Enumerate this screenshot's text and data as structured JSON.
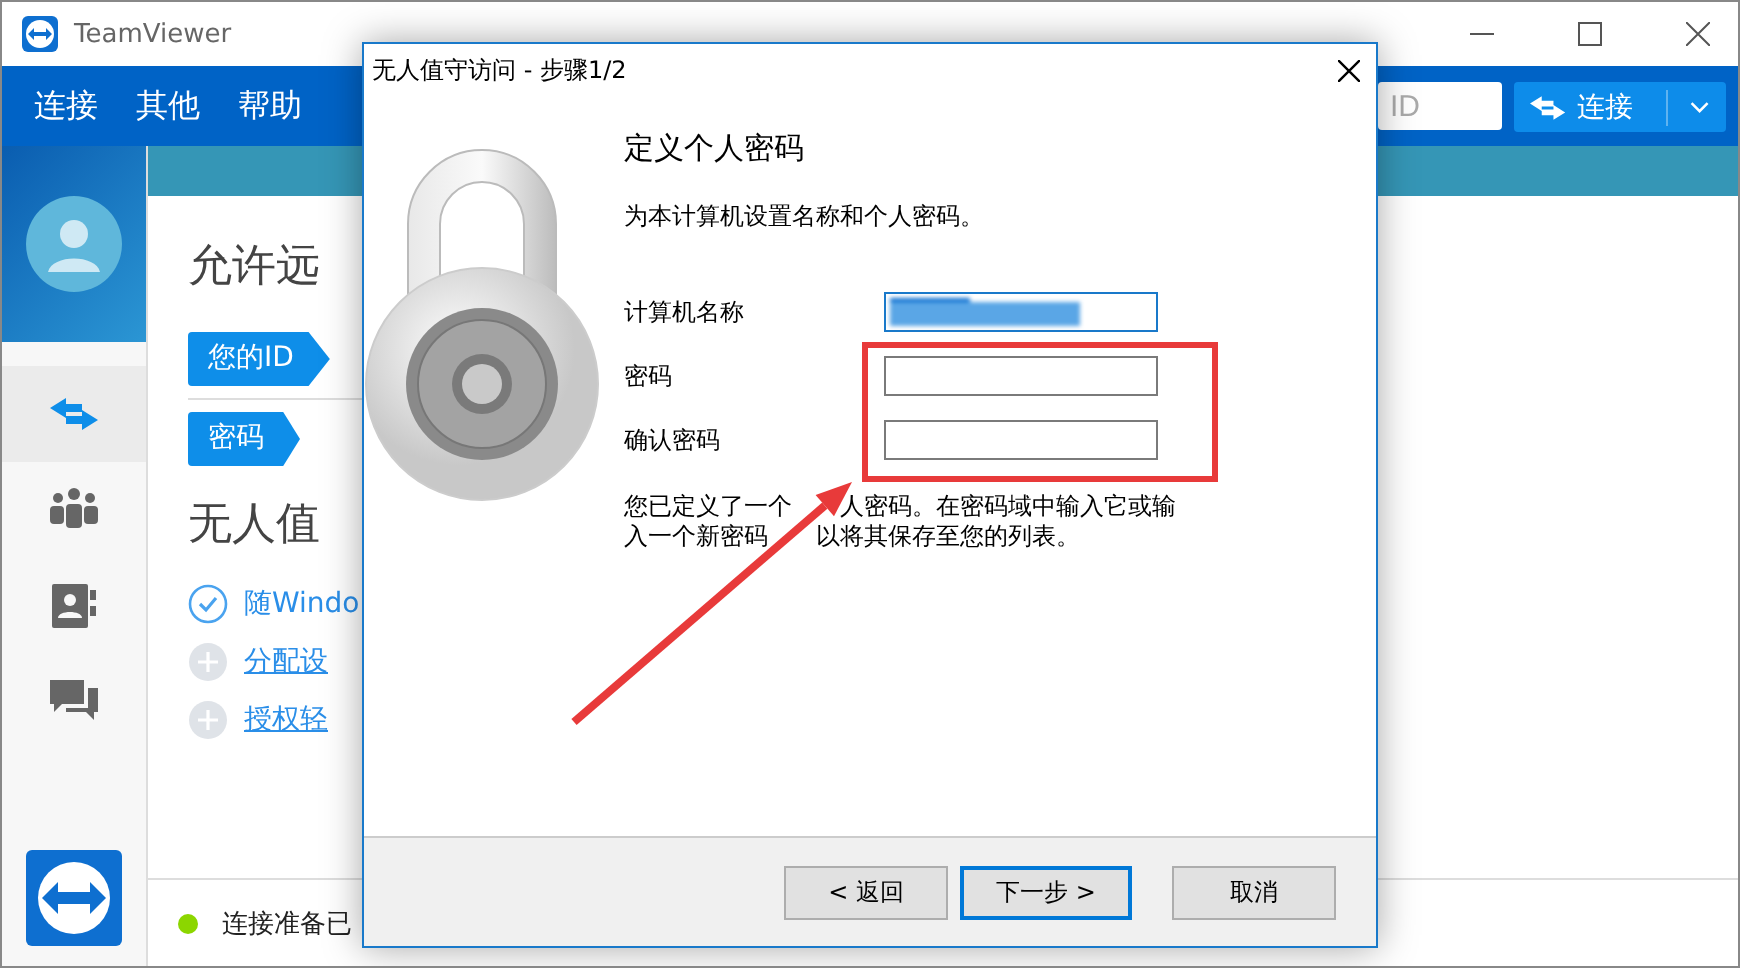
{
  "window": {
    "title": "TeamViewer"
  },
  "menu": [
    {
      "label": "连接"
    },
    {
      "label": "其他"
    },
    {
      "label": "帮助"
    }
  ],
  "partner_id": {
    "placeholder": "ID"
  },
  "connect_button": {
    "label": "连接"
  },
  "sidebar": {
    "items": [
      {
        "kind": "remote",
        "selected": true
      },
      {
        "kind": "meeting",
        "selected": false
      },
      {
        "kind": "contacts",
        "selected": false
      },
      {
        "kind": "chat",
        "selected": false
      }
    ]
  },
  "main": {
    "heading": "允许远",
    "id_tag": "您的ID",
    "password_tag": "密码",
    "unattended_heading": "无人值",
    "steps": [
      {
        "label": "随Windo",
        "done": true
      },
      {
        "label": "分配设",
        "done": false
      },
      {
        "label": "授权轻",
        "done": false
      }
    ]
  },
  "status_bar": {
    "text": "连接准备已",
    "color": "#8cd600"
  },
  "dialog": {
    "title": "无人值守访问 - 步骤1/2",
    "heading": "定义个人密码",
    "description": "为本计算机设置名称和个人密码。",
    "fields": [
      {
        "label": "计算机名称",
        "redacted": true,
        "focused": true
      },
      {
        "label": "密码",
        "redacted": false,
        "focused": false
      },
      {
        "label": "确认密码",
        "redacted": false,
        "focused": false
      }
    ],
    "note_lines": [
      [
        "您已定义了一个",
        "人密码。在密码域中输入它或输"
      ],
      [
        "入一个新密码",
        "以将其保存至您的列表。"
      ]
    ],
    "buttons": [
      {
        "label": "< 返回",
        "focused": false
      },
      {
        "label": "下一步 >",
        "focused": true
      },
      {
        "label": "取消",
        "focused": false
      }
    ]
  }
}
